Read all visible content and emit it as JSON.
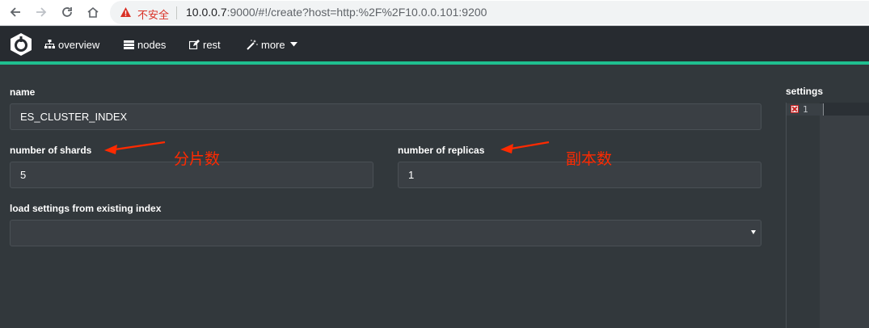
{
  "browser": {
    "insecure_label": "不安全",
    "url_host": "10.0.0.7",
    "url_rest": ":9000/#!/create?host=http:%2F%2F10.0.0.101:9200"
  },
  "navbar": {
    "items": [
      {
        "label": "overview",
        "icon": "sitemap-icon"
      },
      {
        "label": "nodes",
        "icon": "server-icon"
      },
      {
        "label": "rest",
        "icon": "edit-icon"
      },
      {
        "label": "more",
        "icon": "magic-wand-icon"
      }
    ],
    "accent_color": "#1fbf8f"
  },
  "form": {
    "name_label": "name",
    "name_value": "ES_CLUSTER_INDEX",
    "shards_label": "number of shards",
    "shards_value": "5",
    "replicas_label": "number of replicas",
    "replicas_value": "1",
    "load_label": "load settings from existing index",
    "load_value": ""
  },
  "annotations": {
    "shards_note": "分片数",
    "replicas_note": "副本数",
    "color": "#ff2a00"
  },
  "settings": {
    "label": "settings",
    "line_number": "1"
  }
}
